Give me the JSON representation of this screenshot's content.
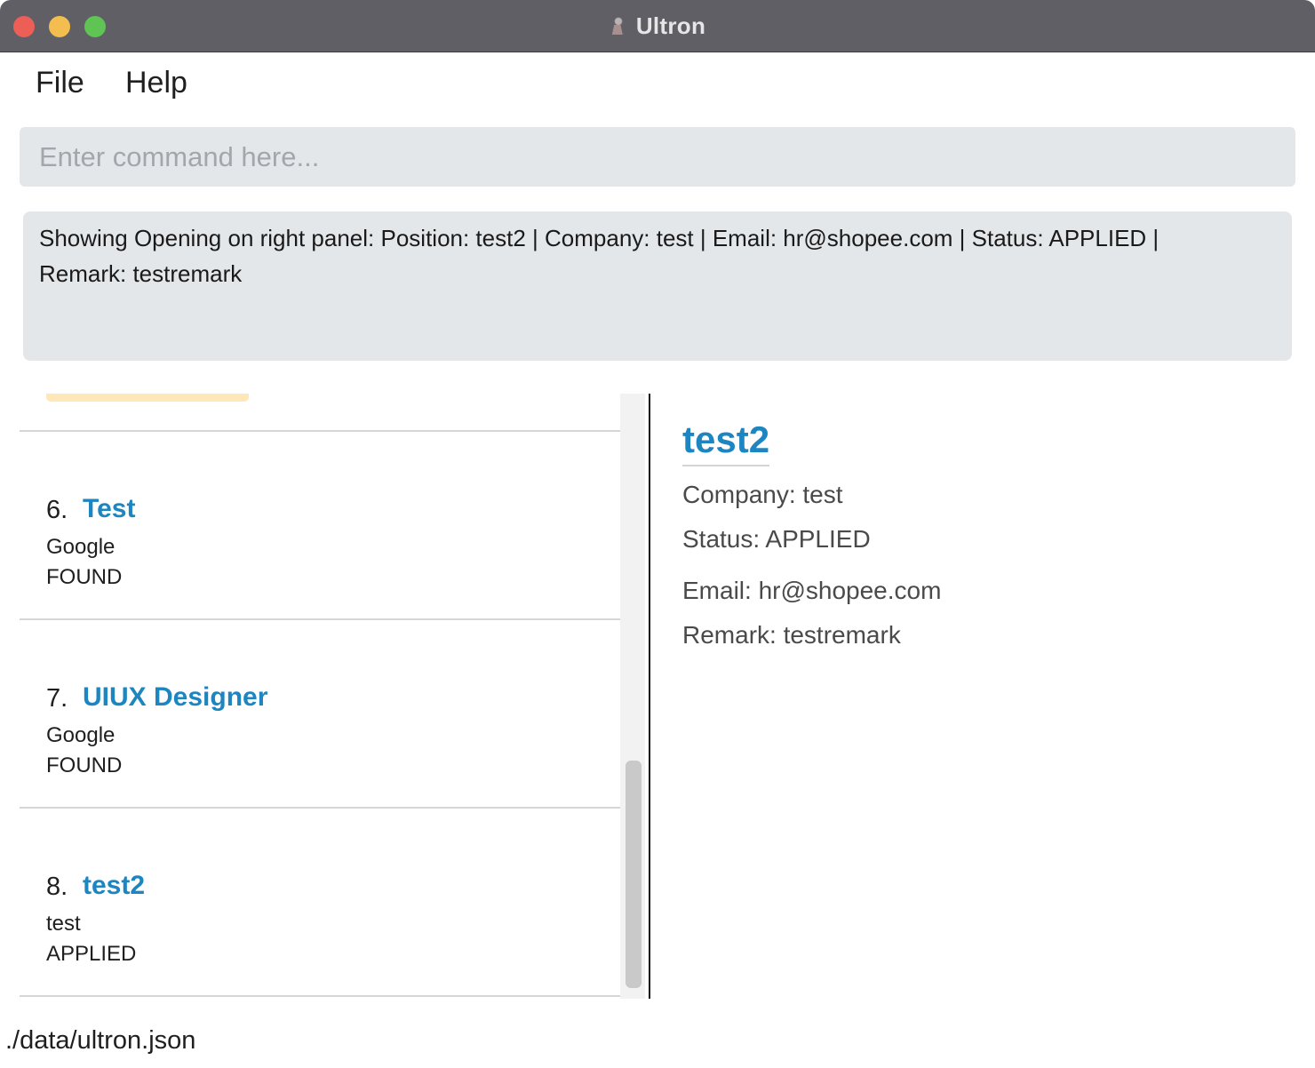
{
  "window": {
    "title": "Ultron"
  },
  "menu": {
    "file_label": "File",
    "help_label": "Help"
  },
  "command": {
    "placeholder": "Enter command here...",
    "value": ""
  },
  "result": {
    "line1": "Showing Opening on right panel: Position: test2 | Company: test | Email: hr@shopee.com | Status: APPLIED |",
    "line2": "Remark: testremark"
  },
  "openings": [
    {
      "index": "6.",
      "position": "Test",
      "company": "Google",
      "status": "FOUND"
    },
    {
      "index": "7.",
      "position": "UIUX Designer",
      "company": "Google",
      "status": "FOUND"
    },
    {
      "index": "8.",
      "position": "test2",
      "company": "test",
      "status": "APPLIED"
    }
  ],
  "detail": {
    "title": "test2",
    "company": "Company: test",
    "status": "Status: APPLIED",
    "email": "Email: hr@shopee.com",
    "remark": "Remark: testremark"
  },
  "statusbar": {
    "path": "./data/ultron.json"
  },
  "colors": {
    "title_accent": "#1d85bf",
    "highlight": "#ffe7b8",
    "titlebar": "#605f66"
  }
}
